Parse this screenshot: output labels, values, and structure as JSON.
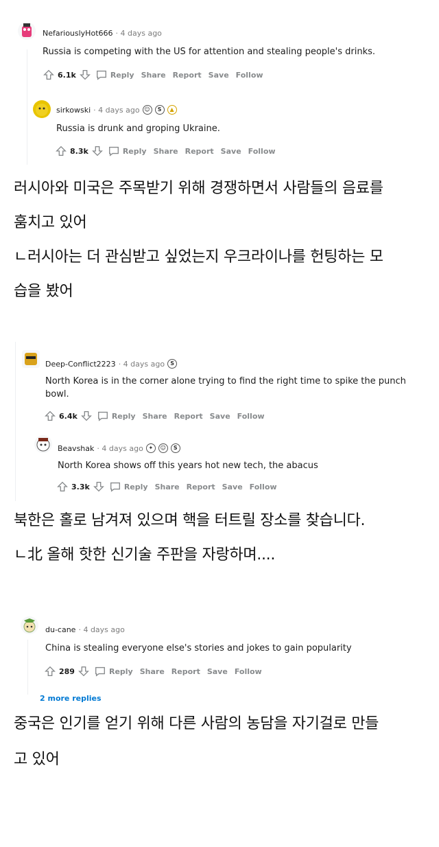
{
  "comments": [
    {
      "user": "NefariouslyHot666",
      "time": "· 4 days ago",
      "text": "Russia is competing with the US for attention and stealing people's drinks.",
      "score": "6.1k"
    },
    {
      "user": "sirkowski",
      "time": "· 4 days ago",
      "text": "Russia is drunk and groping Ukraine.",
      "score": "8.3k"
    },
    {
      "user": "Deep-Conflict2223",
      "time": "· 4 days ago",
      "text1": "North Korea is in the corner alone trying to find the right time to spike the punch",
      "text2": "bowl.",
      "score": "6.4k"
    },
    {
      "user": "Beavshak",
      "time": "· 4 days ago",
      "text": "North Korea shows off this years hot new tech, the abacus",
      "score": "3.3k"
    },
    {
      "user": "du-cane",
      "time": "· 4 days ago",
      "text": "China is stealing everyone else's stories and jokes to gain popularity",
      "score": "289"
    }
  ],
  "actions": {
    "reply": "Reply",
    "share": "Share",
    "report": "Report",
    "save": "Save",
    "follow": "Follow"
  },
  "more_replies": "2 more replies",
  "korean": [
    "러시아와 미국은 주목받기 위해 경쟁하면서 사람들의 음료를",
    "훔치고 있어",
    "ㄴ러시아는 더 관심받고 싶었는지 우크라이나를 헌팅하는 모",
    "습을 봤어",
    "북한은 홀로 남겨져 있으며 핵을 터트릴 장소를 찾습니다.",
    "ㄴ北 올해 핫한 신기술 주판을 자랑하며....",
    "중국은 인기를 얻기 위해 다른 사람의 농담을 자기걸로 만들",
    "고 있어"
  ],
  "colors": {
    "link": "#0079d3",
    "meta": "#7c7c7c",
    "action": "#878a8c"
  }
}
